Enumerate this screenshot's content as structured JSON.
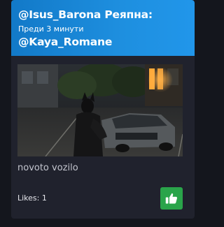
{
  "post": {
    "author": "@Isus_Barona Реяпна:",
    "time": "Преди 3 минути",
    "mention": "@Kaya_Romane",
    "caption": "novoto vozilo",
    "likes_text": "Likes: 1"
  },
  "icons": {
    "like": "thumbs-up-icon"
  },
  "colors": {
    "header_accent": "#1e8fdf",
    "like_button": "#2aa44a",
    "card_background": "#20222d"
  }
}
